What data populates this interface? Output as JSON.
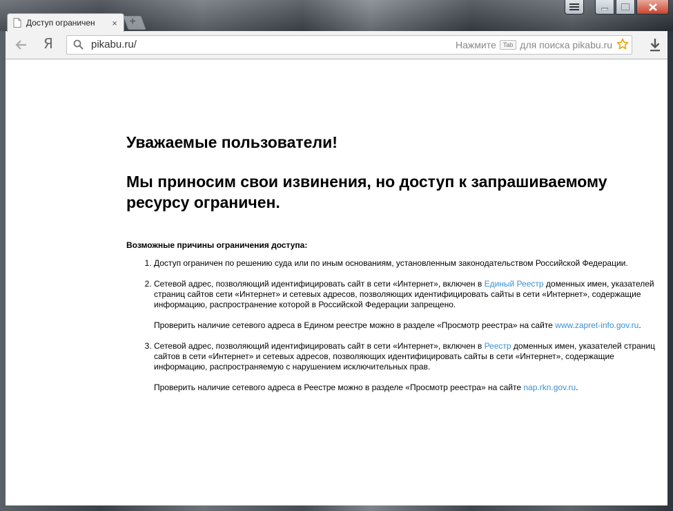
{
  "browser": {
    "tab": {
      "title": "Доступ ограничен",
      "close_glyph": "×",
      "new_tab_glyph": "+"
    },
    "toolbar": {
      "back_icon": "back-arrow-icon",
      "yandex_label": "Я",
      "url": "pikabu.ru/",
      "hint_press": "Нажмите",
      "hint_key": "Tab",
      "hint_search": "для поиска pikabu.ru",
      "star_color": "#f0a000"
    }
  },
  "page": {
    "greeting": "Уважаемые пользователи!",
    "apology": "Мы приносим свои извинения, но доступ к запрашиваемому ресурсу ограничен.",
    "reasons_title": "Возможные причины ограничения доступа:",
    "reasons": {
      "r1": "Доступ ограничен  по решению суда или по иным основаниям, установленным законодательством Российской Федерации.",
      "r2_before": "Сетевой адрес, позволяющий идентифицировать сайт в сети «Интернет», включен в ",
      "r2_link": "Единый Реестр",
      "r2_after": " доменных имен, указателей страниц сайтов сети «Интернет» и сетевых адресов, позволяющих идентифицировать сайты в сети «Интернет», содержащие информацию, распространение которой в Российской Федерации запрещено.",
      "r2_check_before": "Проверить наличие сетевого адреса в Едином реестре можно в разделе «Просмотр реестра» на сайте ",
      "r2_check_link": "www.zapret-info.gov.ru",
      "r2_check_after": ".",
      "r3_before": "Сетевой адрес, позволяющий идентифицировать сайт в сети «Интернет», включен в ",
      "r3_link": "Реестр",
      "r3_after": " доменных имен, указателей страниц сайтов в сети «Интернет» и сетевых адресов, позволяющих идентифицировать сайты в сети «Интернет», содержащие информацию, распространяемую с нарушением исключительных прав.",
      "r3_check_before": "Проверить наличие сетевого адреса в Реестре можно в разделе «Просмотр реестра» на сайте ",
      "r3_check_link": "nap.rkn.gov.ru",
      "r3_check_after": "."
    }
  },
  "colors": {
    "link": "#3a8fd0",
    "close_button": "#c7452f"
  }
}
